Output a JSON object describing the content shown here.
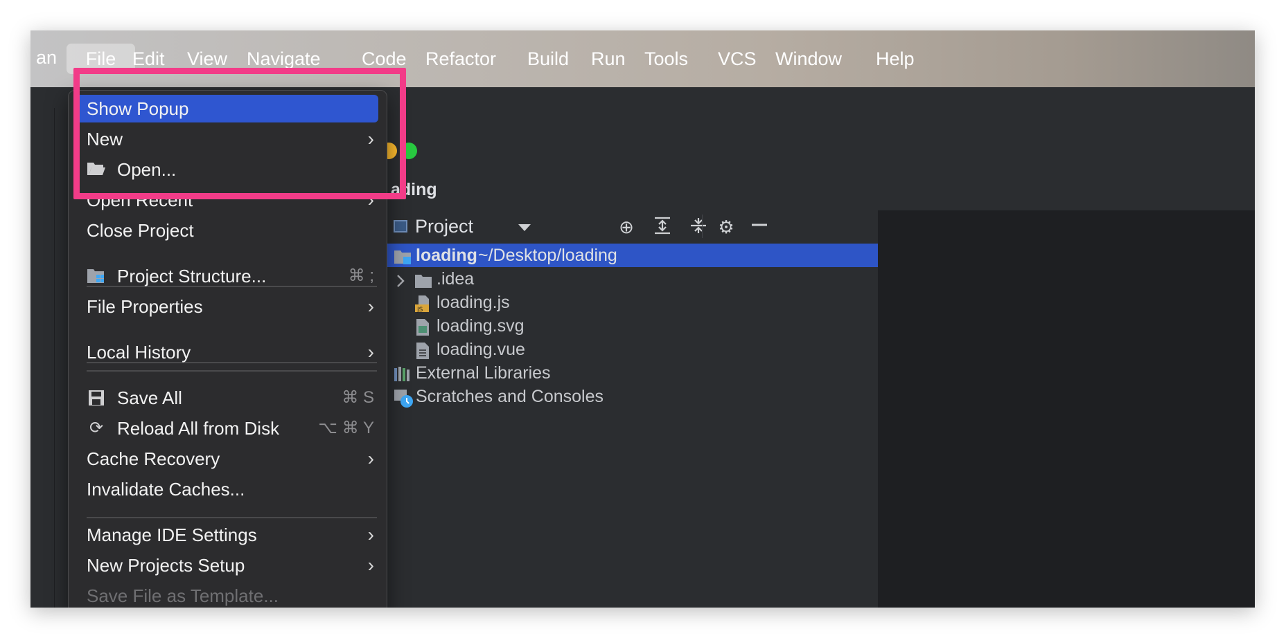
{
  "menubar": {
    "app_name": "an",
    "items": [
      "File",
      "Edit",
      "View",
      "Navigate",
      "Code",
      "Refactor",
      "Build",
      "Run",
      "Tools",
      "VCS",
      "Window",
      "Help"
    ]
  },
  "ide": {
    "project_title": "ading",
    "panel": {
      "title": "Project"
    },
    "tree": [
      {
        "name": "loading",
        "path": "~/Desktop/loading"
      },
      {
        "name": ".idea"
      },
      {
        "name": "loading.js"
      },
      {
        "name": "loading.svg"
      },
      {
        "name": "loading.vue"
      },
      {
        "name": "External Libraries"
      },
      {
        "name": "Scratches and Consoles"
      }
    ]
  },
  "file_menu": {
    "items": [
      {
        "label": "Show Popup"
      },
      {
        "label": "New"
      },
      {
        "label": "Open..."
      },
      {
        "label": "Open Recent"
      },
      {
        "label": "Close Project"
      },
      {
        "label": "Project Structure...",
        "shortcut": "⌘ ;"
      },
      {
        "label": "File Properties"
      },
      {
        "label": "Local History"
      },
      {
        "label": "Save All",
        "shortcut": "⌘ S"
      },
      {
        "label": "Reload All from Disk",
        "shortcut": "⌥ ⌘ Y"
      },
      {
        "label": "Cache Recovery"
      },
      {
        "label": "Invalidate Caches..."
      },
      {
        "label": "Manage IDE Settings"
      },
      {
        "label": "New Projects Setup"
      },
      {
        "label": "Save File as Template..."
      }
    ]
  },
  "colors": {
    "highlight": "#2f56d0",
    "annotation": "#f23c88",
    "selection": "#2e55c6"
  }
}
